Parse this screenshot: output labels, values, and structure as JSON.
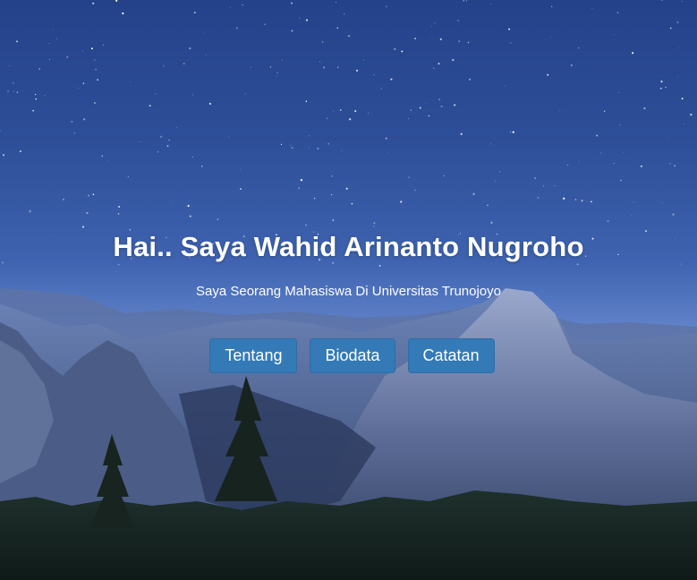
{
  "hero": {
    "title": "Hai.. Saya Wahid Arinanto Nugroho",
    "subtitle": "Saya Seorang Mahasiswa Di Universitas Trunojoyo",
    "background": "night-sky-mountain-landscape"
  },
  "nav_buttons": [
    {
      "label": "Tentang"
    },
    {
      "label": "Biodata"
    },
    {
      "label": "Catatan"
    }
  ],
  "colors": {
    "button_bg": "#337ab7",
    "text": "#ffffff",
    "sky_top": "#24428a",
    "sky_horizon": "#6f8fd0"
  }
}
